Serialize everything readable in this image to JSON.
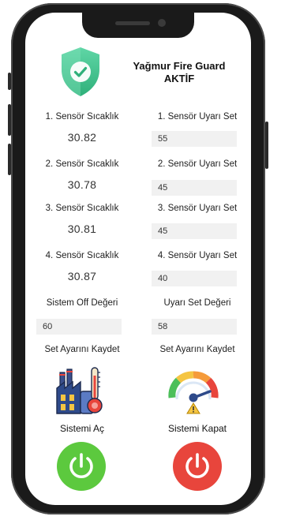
{
  "header": {
    "app_name": "Yağmur Fire Guard",
    "status": "AKTİF"
  },
  "sensors": [
    {
      "temp_label": "1. Sensör Sıcaklık",
      "temp_value": "30.82",
      "alarm_label": "1. Sensör Uyarı Set",
      "alarm_value": "55"
    },
    {
      "temp_label": "2. Sensör Sıcaklık",
      "temp_value": "30.78",
      "alarm_label": "2. Sensör Uyarı Set",
      "alarm_value": "45"
    },
    {
      "temp_label": "3. Sensör Sıcaklık",
      "temp_value": "30.81",
      "alarm_label": "3. Sensör Uyarı Set",
      "alarm_value": "45"
    },
    {
      "temp_label": "4. Sensör Sıcaklık",
      "temp_value": "30.87",
      "alarm_label": "4. Sensör Uyarı Set",
      "alarm_value": "40"
    }
  ],
  "system_off": {
    "label": "Sistem Off Değeri",
    "value": "60",
    "save_label": "Set Ayarını Kaydet"
  },
  "alarm_set": {
    "label": "Uyarı Set Değeri",
    "value": "58",
    "save_label": "Set Ayarını Kaydet"
  },
  "power": {
    "on_label": "Sistemi Aç",
    "off_label": "Sistemi Kapat"
  },
  "colors": {
    "shield": "#3fc08c",
    "on": "#5cc93e",
    "off": "#e8453c"
  },
  "icons": {
    "shield": "shield-check-icon",
    "factory": "factory-thermometer-icon",
    "gauge": "pressure-gauge-icon",
    "power": "power-icon"
  }
}
